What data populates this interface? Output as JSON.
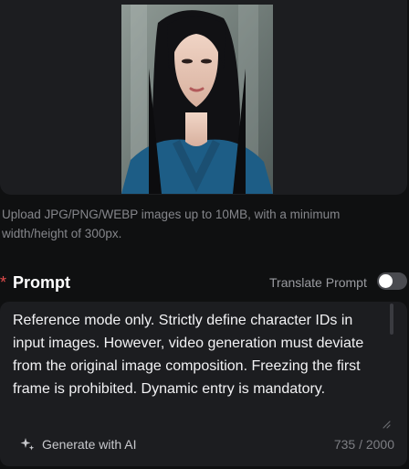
{
  "upload": {
    "help_text": "Upload JPG/PNG/WEBP images up to 10MB, with a minimum width/height of 300px."
  },
  "prompt": {
    "required_mark": "*",
    "title": "Prompt",
    "translate_label": "Translate Prompt",
    "translate_enabled": false,
    "text": "Reference mode only. Strictly define character IDs in input images. However, video generation must deviate from the original image composition. Freezing the first frame is prohibited. Dynamic entry is mandatory.",
    "generate_label": "Generate with AI",
    "counter": "735 / 2000"
  },
  "colors": {
    "background": "#0f1011",
    "panel": "#1c1d20",
    "required": "#e24c4c",
    "toggle_off": "#4a4b50"
  },
  "icons": {
    "generate": "sparkle-icon",
    "resize": "resize-handle-icon"
  }
}
